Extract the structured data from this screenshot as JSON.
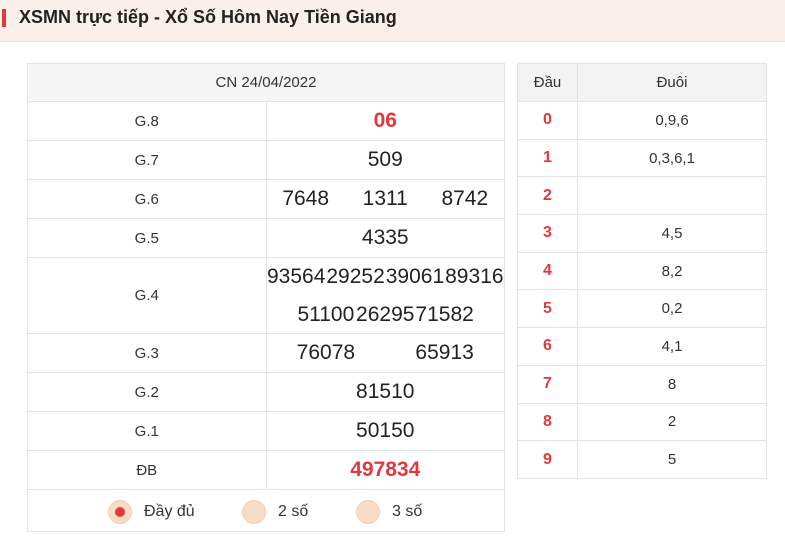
{
  "header": {
    "title": "XSMN trực tiếp - Xổ Số Hôm Nay Tiền Giang"
  },
  "results": {
    "date": "CN 24/04/2022",
    "prizes": [
      {
        "label": "G.8",
        "numbers": [
          "06"
        ]
      },
      {
        "label": "G.7",
        "numbers": [
          "509"
        ]
      },
      {
        "label": "G.6",
        "numbers": [
          "7648",
          "1311",
          "8742"
        ]
      },
      {
        "label": "G.5",
        "numbers": [
          "4335"
        ]
      },
      {
        "label": "G.4",
        "numbers": [
          "93564",
          "29252",
          "39061",
          "89316",
          "51100",
          "26295",
          "71582"
        ]
      },
      {
        "label": "G.3",
        "numbers": [
          "76078",
          "65913"
        ]
      },
      {
        "label": "G.2",
        "numbers": [
          "81510"
        ]
      },
      {
        "label": "G.1",
        "numbers": [
          "50150"
        ]
      },
      {
        "label": "ĐB",
        "numbers": [
          "497834"
        ]
      }
    ],
    "options": [
      {
        "label": "Đầy đủ",
        "selected": true
      },
      {
        "label": "2 số",
        "selected": false
      },
      {
        "label": "3 số",
        "selected": false
      }
    ]
  },
  "loto": {
    "head_label": "Đầu",
    "tail_label": "Đuôi",
    "rows": [
      {
        "head": "0",
        "tail": "0,9,6"
      },
      {
        "head": "1",
        "tail": "0,3,6,1"
      },
      {
        "head": "2",
        "tail": ""
      },
      {
        "head": "3",
        "tail": "4,5"
      },
      {
        "head": "4",
        "tail": "8,2"
      },
      {
        "head": "5",
        "tail": "0,2"
      },
      {
        "head": "6",
        "tail": "4,1"
      },
      {
        "head": "7",
        "tail": "8"
      },
      {
        "head": "8",
        "tail": "2"
      },
      {
        "head": "9",
        "tail": "5"
      }
    ]
  },
  "colors": {
    "accent": "#e4393c",
    "header_bg": "#fbefeb",
    "options_bg": "#fdf6ea"
  }
}
